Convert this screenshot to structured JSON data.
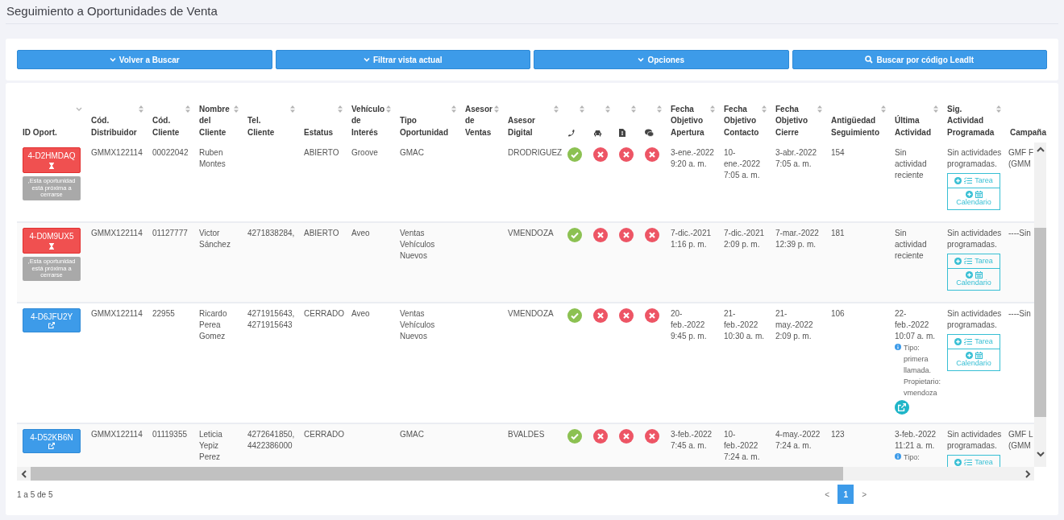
{
  "page_title": "Seguimiento a Oportunidades de Venta",
  "toolbar": [
    {
      "label": "Volver a Buscar",
      "kind": "dropdown"
    },
    {
      "label": "Filtrar vista actual",
      "kind": "dropdown"
    },
    {
      "label": "Opciones",
      "kind": "dropdown"
    },
    {
      "label": "Buscar por código LeadIt",
      "kind": "search"
    }
  ],
  "table": {
    "columns": [
      {
        "label": "ID Oport.",
        "kind": "text",
        "sorted": true
      },
      {
        "label": "Cód. Distribuidor",
        "kind": "text",
        "sorted": false
      },
      {
        "label": "Cód. Cliente",
        "kind": "text",
        "sorted": false
      },
      {
        "label": "Nombre del Cliente",
        "kind": "text",
        "sorted": false
      },
      {
        "label": "Tel. Cliente",
        "kind": "text",
        "sorted": false
      },
      {
        "label": "Estatus",
        "kind": "text",
        "sorted": false
      },
      {
        "label": "Vehículo de Interés",
        "kind": "text",
        "sorted": false
      },
      {
        "label": "Tipo Oportunidad",
        "kind": "text",
        "sorted": false
      },
      {
        "label": "Asesor de Ventas",
        "kind": "text",
        "sorted": false
      },
      {
        "label": "Asesor Digital",
        "kind": "text",
        "sorted": false
      },
      {
        "kind": "icon",
        "sorted": false
      },
      {
        "kind": "icon",
        "sorted": false
      },
      {
        "kind": "icon",
        "sorted": false
      },
      {
        "kind": "icon",
        "sorted": false
      },
      {
        "label": "Fecha Objetivo Apertura",
        "kind": "text",
        "sorted": false
      },
      {
        "label": "Fecha Objetivo Contacto",
        "kind": "text",
        "sorted": false
      },
      {
        "label": "Fecha Objetivo Cierre",
        "kind": "text",
        "sorted": false
      },
      {
        "label": "Antigüedad Seguimiento",
        "kind": "text",
        "sorted": false
      },
      {
        "label": "Última Actividad",
        "kind": "text",
        "sorted": false
      },
      {
        "label": "Sig. Actividad Programada",
        "kind": "text",
        "sorted": false
      },
      {
        "label": "Campaña",
        "kind": "text"
      }
    ],
    "rows": [
      {
        "id": "4-D2HMDAQ",
        "expiring": true,
        "warning": ",Esta oportunidad está próxima a cerrarse",
        "cod_distribuidor": "GMMX122114",
        "cod_cliente": "00022042",
        "nombre": "Ruben Montes",
        "estatus": "ABIERTO",
        "vehiculo": "Groove",
        "tipo": "GMAC",
        "asesor_digital": "DRODRIGUEZ",
        "checks": [
          {
            "ok": true
          },
          {
            "ok": false
          },
          {
            "ok": false
          },
          {
            "ok": false
          }
        ],
        "fecha_apertura": "3-ene.-2022 9:20 a. m.",
        "fecha_contacto": "10-ene.-2022 7:05 a. m.",
        "fecha_cierre": "3-abr.-2022 7:05 a. m.",
        "antiguedad": "154",
        "ultima": {
          "text": "Sin actividad reciente",
          "link": false
        },
        "sig_actividad": "Sin actividades programadas.",
        "actions": [
          "Tarea",
          "Calendario"
        ],
        "campana": "GMF F (GMM"
      },
      {
        "id": "4-D0M9UX5",
        "expiring": true,
        "warning": ",Esta oportunidad está próxima a cerrarse",
        "cod_distribuidor": "GMMX122114",
        "cod_cliente": "01127777",
        "nombre": "Victor Sánchez",
        "telefono": "4271838284,",
        "estatus": "ABIERTO",
        "vehiculo": "Aveo",
        "tipo": "Ventas Vehículos Nuevos",
        "asesor_digital": "VMENDOZA",
        "checks": [
          {
            "ok": true
          },
          {
            "ok": false
          },
          {
            "ok": false
          },
          {
            "ok": false
          }
        ],
        "fecha_apertura": "7-dic.-2021 1:16 p. m.",
        "fecha_contacto": "7-dic.-2021 2:09 p. m.",
        "fecha_cierre": "7-mar.-2022 12:39 p. m.",
        "antiguedad": "181",
        "ultima": {
          "text": "Sin actividad reciente",
          "link": false
        },
        "sig_actividad": "Sin actividades programadas.",
        "actions": [
          "Tarea",
          "Calendario"
        ],
        "campana": "----Sin"
      },
      {
        "id": "4-D6JFU2Y",
        "expiring": false,
        "cod_distribuidor": "GMMX122114",
        "cod_cliente": "22955",
        "nombre": "Ricardo Perea Gomez",
        "telefono": "4271915643, 4271915643",
        "estatus": "CERRADO",
        "vehiculo": "Aveo",
        "tipo": "Ventas Vehículos Nuevos",
        "asesor_digital": "VMENDOZA",
        "checks": [
          {
            "ok": true
          },
          {
            "ok": false
          },
          {
            "ok": false
          },
          {
            "ok": false
          }
        ],
        "fecha_apertura": "20-feb.-2022 9:45 p. m.",
        "fecha_contacto": "21-feb.-2022 10:30 a. m.",
        "fecha_cierre": "21-may.-2022 2:09 p. m.",
        "antiguedad": "106",
        "ultima": {
          "text": "22-feb.-2022 10:07 a. m.",
          "note": "Tipo: primera llamada. Propietario: vmendoza",
          "link": true
        },
        "sig_actividad": "Sin actividades programadas.",
        "actions": [
          "Tarea",
          "Calendario"
        ],
        "campana": "----Sin"
      },
      {
        "id": "4-D52KB6N",
        "expiring": false,
        "cod_distribuidor": "GMMX122114",
        "cod_cliente": "01119355",
        "nombre": "Leticia Yepiz Perez",
        "telefono": "4272641850, 4422386000",
        "estatus": "CERRADO",
        "tipo": "GMAC",
        "asesor_digital": "BVALDES",
        "checks": [
          {
            "ok": true
          },
          {
            "ok": false
          },
          {
            "ok": false
          },
          {
            "ok": false
          }
        ],
        "fecha_apertura": "3-feb.-2022 7:45 a. m.",
        "fecha_contacto": "10-feb.-2022 7:24 a. m.",
        "fecha_cierre": "4-may.-2022 7:24 a. m.",
        "antiguedad": "123",
        "ultima": {
          "text": "3-feb.-2022 11:21 a. m.",
          "note": "Tipo:",
          "link": false
        },
        "sig_actividad": "Sin actividades programadas.",
        "actions": [
          "Tarea"
        ],
        "campana": "GMF L (GMM"
      }
    ]
  },
  "footer": {
    "summary": "1 a 5 de 5",
    "prev": "<",
    "next": ">",
    "pages": [
      {
        "label": "1",
        "selected": true
      }
    ]
  }
}
